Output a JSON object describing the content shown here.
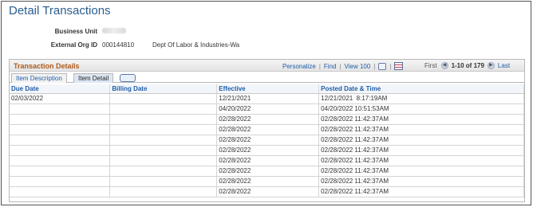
{
  "page": {
    "title": "Detail Transactions"
  },
  "info": {
    "business_unit_label": "Business Unit",
    "external_org_label": "External Org ID",
    "external_org_id": "000144810",
    "external_org_name": "Dept Of Labor & Industries-Wa"
  },
  "grid": {
    "title": "Transaction Details",
    "toolbar": {
      "personalize": "Personalize",
      "find": "Find",
      "view": "View 100",
      "first": "First",
      "range": "1-10 of 179",
      "last": "Last"
    },
    "tabs": [
      {
        "label": "Item Description",
        "active": false
      },
      {
        "label": "Item Detail",
        "active": true
      }
    ],
    "columns": [
      "Due Date",
      "Billing Date",
      "Effective",
      "Posted Date & Time"
    ],
    "rows": [
      [
        "02/03/2022",
        "",
        "12/21/2021",
        "12/21/2021  8:17:19AM"
      ],
      [
        "",
        "",
        "04/20/2022",
        "04/20/2022 10:51:53AM"
      ],
      [
        "",
        "",
        "02/28/2022",
        "02/28/2022 11:42:37AM"
      ],
      [
        "",
        "",
        "02/28/2022",
        "02/28/2022 11:42:37AM"
      ],
      [
        "",
        "",
        "02/28/2022",
        "02/28/2022 11:42:37AM"
      ],
      [
        "",
        "",
        "02/28/2022",
        "02/28/2022 11:42:37AM"
      ],
      [
        "",
        "",
        "02/28/2022",
        "02/28/2022 11:42:37AM"
      ],
      [
        "",
        "",
        "02/28/2022",
        "02/28/2022 11:42:37AM"
      ],
      [
        "",
        "",
        "02/28/2022",
        "02/28/2022 11:42:37AM"
      ],
      [
        "",
        "",
        "02/28/2022",
        "02/28/2022 11:42:37AM"
      ]
    ]
  }
}
